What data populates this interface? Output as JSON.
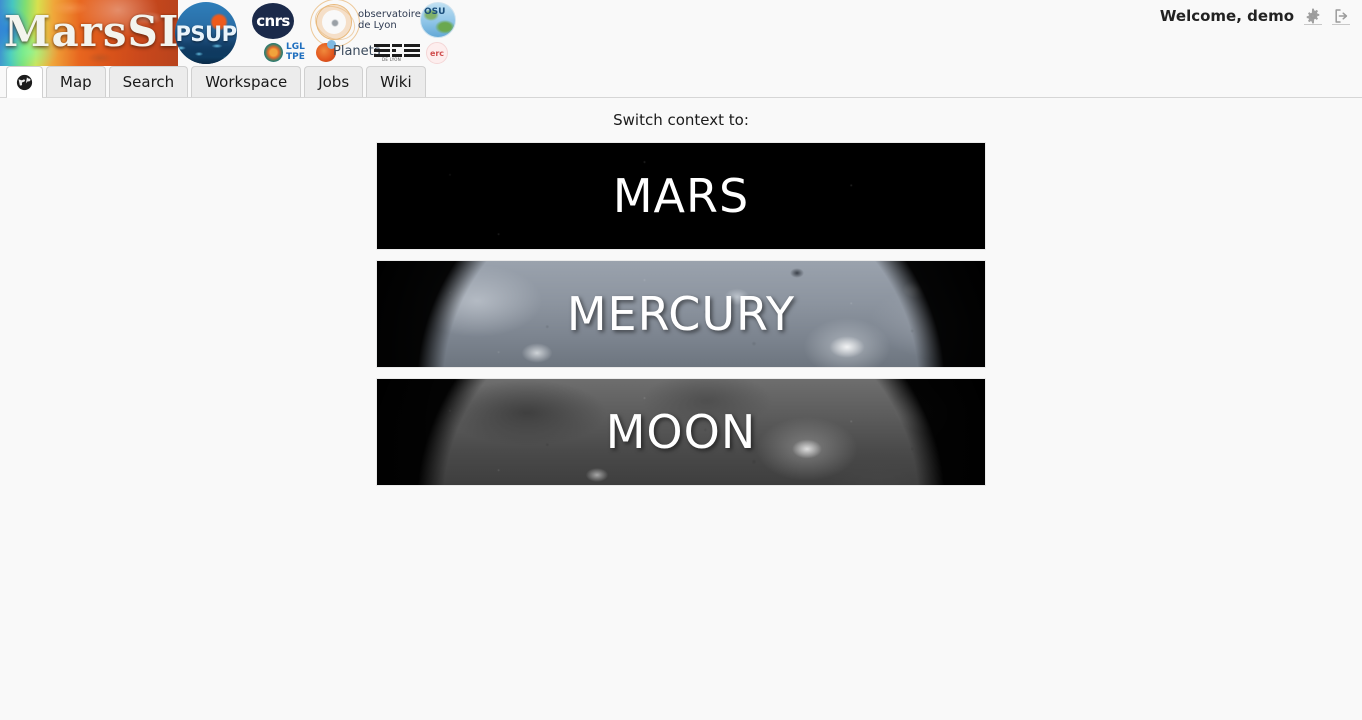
{
  "app": {
    "brand_name": "MarsSI",
    "psup_label": "PSUP"
  },
  "partners": [
    {
      "name": "cnrs-logo",
      "label": "cnrs"
    },
    {
      "name": "observatoire-de-lyon-logo",
      "label": "observatoire\nde Lyon",
      "line1": "observatoire",
      "line2": "de Lyon"
    },
    {
      "name": "osu-globe-logo",
      "label": "OSU"
    },
    {
      "name": "lgl-tpe-logo",
      "line1": "LGL",
      "line2": "TPE"
    },
    {
      "name": "planets-logo",
      "label": "Planets"
    },
    {
      "name": "ens-logo",
      "label": "ENS",
      "sub": "DE LYON"
    },
    {
      "name": "erc-logo",
      "label": "erc"
    }
  ],
  "account": {
    "welcome": "Welcome, demo",
    "settings_icon": "gear-icon",
    "logout_icon": "sign-out-icon"
  },
  "tabs": [
    {
      "id": "home",
      "label": "",
      "icon": "globe-icon",
      "active": true
    },
    {
      "id": "map",
      "label": "Map",
      "active": false
    },
    {
      "id": "search",
      "label": "Search",
      "active": false
    },
    {
      "id": "workspace",
      "label": "Workspace",
      "active": false
    },
    {
      "id": "jobs",
      "label": "Jobs",
      "active": false
    },
    {
      "id": "wiki",
      "label": "Wiki",
      "active": false
    }
  ],
  "main": {
    "switch_label": "Switch context to:",
    "contexts": [
      {
        "id": "mars",
        "label": "MARS"
      },
      {
        "id": "mercury",
        "label": "MERCURY"
      },
      {
        "id": "moon",
        "label": "MOON"
      }
    ]
  },
  "colors": {
    "page_background": "#f9f9f9",
    "tab_active_background": "#ffffff",
    "tab_inactive_background": "#ececec",
    "tab_border": "#d0d0d0",
    "text_primary": "#1a1a1a",
    "icon_gray": "#9b9b9b",
    "banner_text": "#ffffff"
  }
}
